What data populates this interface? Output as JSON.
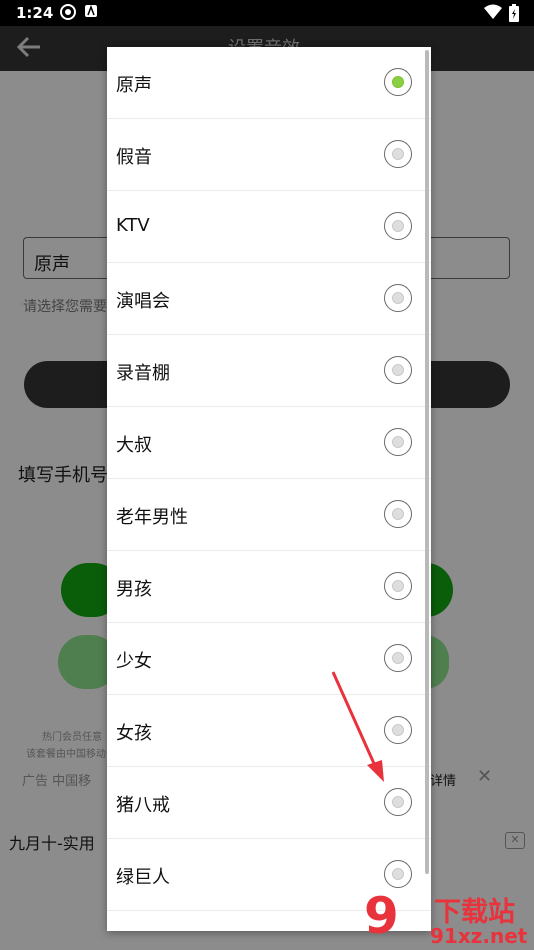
{
  "status_bar": {
    "time": "1:24"
  },
  "toolbar": {
    "title": "设置音效"
  },
  "background": {
    "input_value": "原声",
    "hint": "请选择您需要",
    "section_label": "填写手机号",
    "small_text1": "热门会员任意",
    "small_text2": "该套餐由中国移动",
    "ad_label": "广告 中国移",
    "details": "详情",
    "close_symbol": "✕",
    "bottom_title": "九月十-实用",
    "bottom_close": "✕"
  },
  "dialog": {
    "options": [
      {
        "label": "原声",
        "selected": true
      },
      {
        "label": "假音",
        "selected": false
      },
      {
        "label": "KTV",
        "selected": false
      },
      {
        "label": "演唱会",
        "selected": false
      },
      {
        "label": "录音棚",
        "selected": false
      },
      {
        "label": "大叔",
        "selected": false
      },
      {
        "label": "老年男性",
        "selected": false
      },
      {
        "label": "男孩",
        "selected": false
      },
      {
        "label": "少女",
        "selected": false
      },
      {
        "label": "女孩",
        "selected": false
      },
      {
        "label": "猪八戒",
        "selected": false
      },
      {
        "label": "绿巨人",
        "selected": false
      }
    ]
  },
  "watermark": {
    "brand": "下载站",
    "url": "91xz.net",
    "logo_digit": "9"
  },
  "colors": {
    "accent_red": "#e8323c",
    "radio_selected": "#8bd043"
  }
}
